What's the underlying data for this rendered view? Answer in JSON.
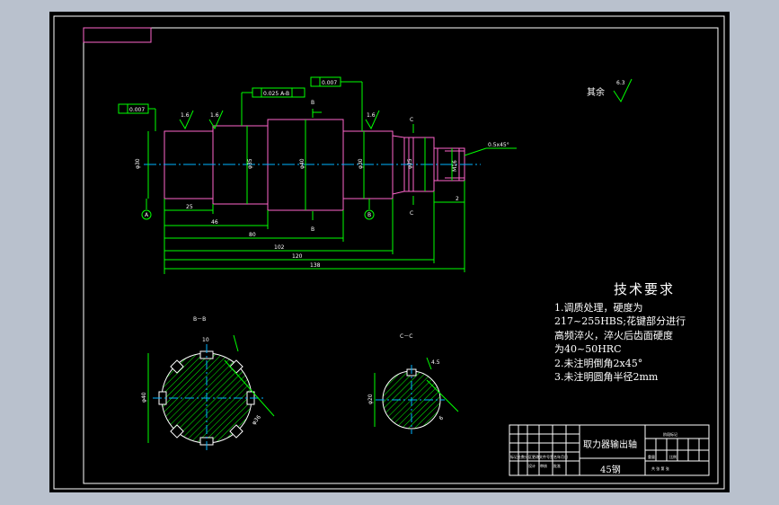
{
  "drawing": {
    "roughness_note": "其余",
    "roughness_value": "6.3",
    "tech_requirements": {
      "title": "技术要求",
      "lines": [
        "1.调质处理，硬度为",
        "217~255HBS;花键部分进行",
        "高频淬火，淬火后齿面硬度",
        "为40~50HRC",
        "2.未注明倒角2x45°",
        "3.未注明圆角半径2mm"
      ]
    },
    "title_block": {
      "part_name": "取力器输出轴",
      "material": "45钢",
      "small_text": "标记处数分区更改文件号签名年月日",
      "small_text_2": "设计",
      "small_text_3": "审核",
      "small_text_4": "批准",
      "scale_label": "阶段标记",
      "misc_1": "重量",
      "misc_2": "比例",
      "sheet": "共 张  第 张"
    },
    "sections": {
      "b_label": "B－B",
      "c_label": "C－C"
    },
    "dimensions": {
      "d1": "25",
      "d2": "46",
      "d3": "80",
      "d4": "102",
      "d5": "120",
      "d6": "138",
      "d7": "2",
      "thread": "M16",
      "chamfer": "0.5x45°",
      "tol1": "0.007",
      "tol2": "0.025  A-B",
      "tol3": "0.007",
      "dia_a": "φ30",
      "dia_b": "φ35",
      "dia_c": "φ40",
      "dia_d": "φ30",
      "dia_e": "φ25",
      "rough_16a": "1.6",
      "rough_16b": "1.6",
      "rough_16c": "1.6",
      "datum_a": "A",
      "datum_b": "B",
      "sec_b": "B",
      "sec_c": "C",
      "sec_dim_b1": "φ40",
      "sec_dim_b2": "φ36",
      "sec_dim_b3": "10",
      "sec_dim_c1": "φ20",
      "sec_dim_c2": "4.5",
      "sec_dim_c3": "6"
    }
  }
}
